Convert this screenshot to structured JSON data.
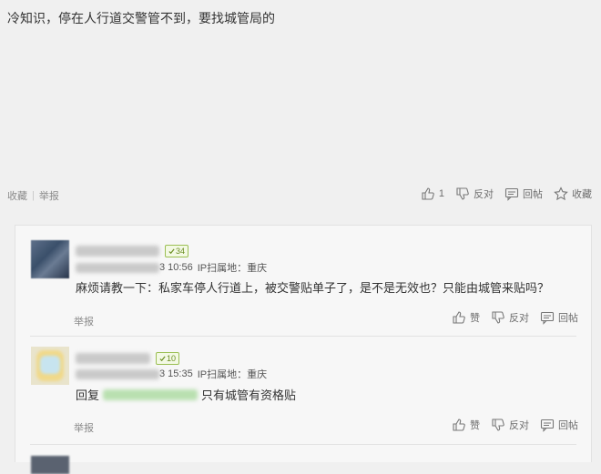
{
  "post": {
    "text": "冷知识，停在人行道交警管不到，要找城管局的"
  },
  "post_actions_left": {
    "collect": "收藏",
    "report": "举报"
  },
  "post_actions_right": {
    "like_count": "1",
    "dislike": "反对",
    "reply": "回帖",
    "favorite": "收藏"
  },
  "replies": [
    {
      "level": "34",
      "time": "3 10:56",
      "ip": "IP扫属地：重庆",
      "text": "麻烦请教一下：私家车停人行道上，被交警贴单子了，是不是无效也？只能由城管来贴吗？",
      "report": "举报",
      "like": "赞",
      "dislike": "反对",
      "reply": "回帖"
    },
    {
      "level": "10",
      "time": "3 15:35",
      "ip": "IP扫属地：重庆",
      "reply_prefix": "回复",
      "text": "只有城管有资格贴",
      "report": "举报",
      "like": "赞",
      "dislike": "反对",
      "reply": "回帖"
    }
  ]
}
